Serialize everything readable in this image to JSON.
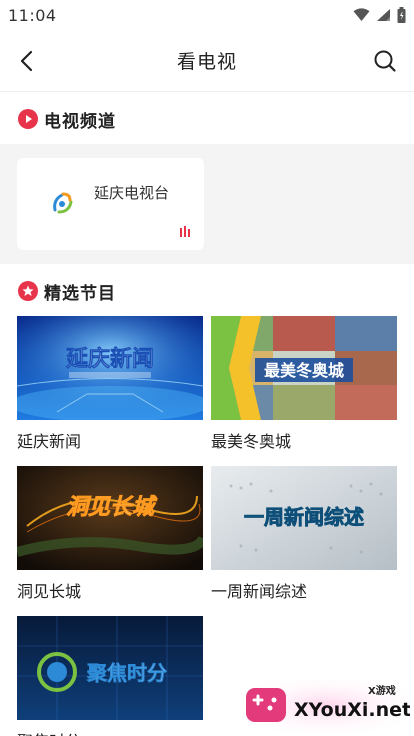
{
  "status_bar": {
    "time": "11:04"
  },
  "header": {
    "title": "看电视"
  },
  "channels_section": {
    "title": "电视频道",
    "channels": [
      {
        "name": "延庆电视台"
      }
    ]
  },
  "programs_section": {
    "title": "精选节目",
    "programs": [
      {
        "title": "延庆新闻",
        "thumb_text": "延庆新闻"
      },
      {
        "title": "最美冬奥城",
        "thumb_text": "最美冬奥城"
      },
      {
        "title": "洞见长城",
        "thumb_text": "洞见长城"
      },
      {
        "title": "一周新闻综述",
        "thumb_text": "一周新闻综述"
      },
      {
        "title": "聚焦时分",
        "thumb_text": "聚焦时分"
      }
    ]
  },
  "watermark": {
    "small_label": "X游戏",
    "brand": "XYouXi.net"
  },
  "colors": {
    "accent": "#e8344a",
    "strip_bg": "#f4f4f4"
  }
}
